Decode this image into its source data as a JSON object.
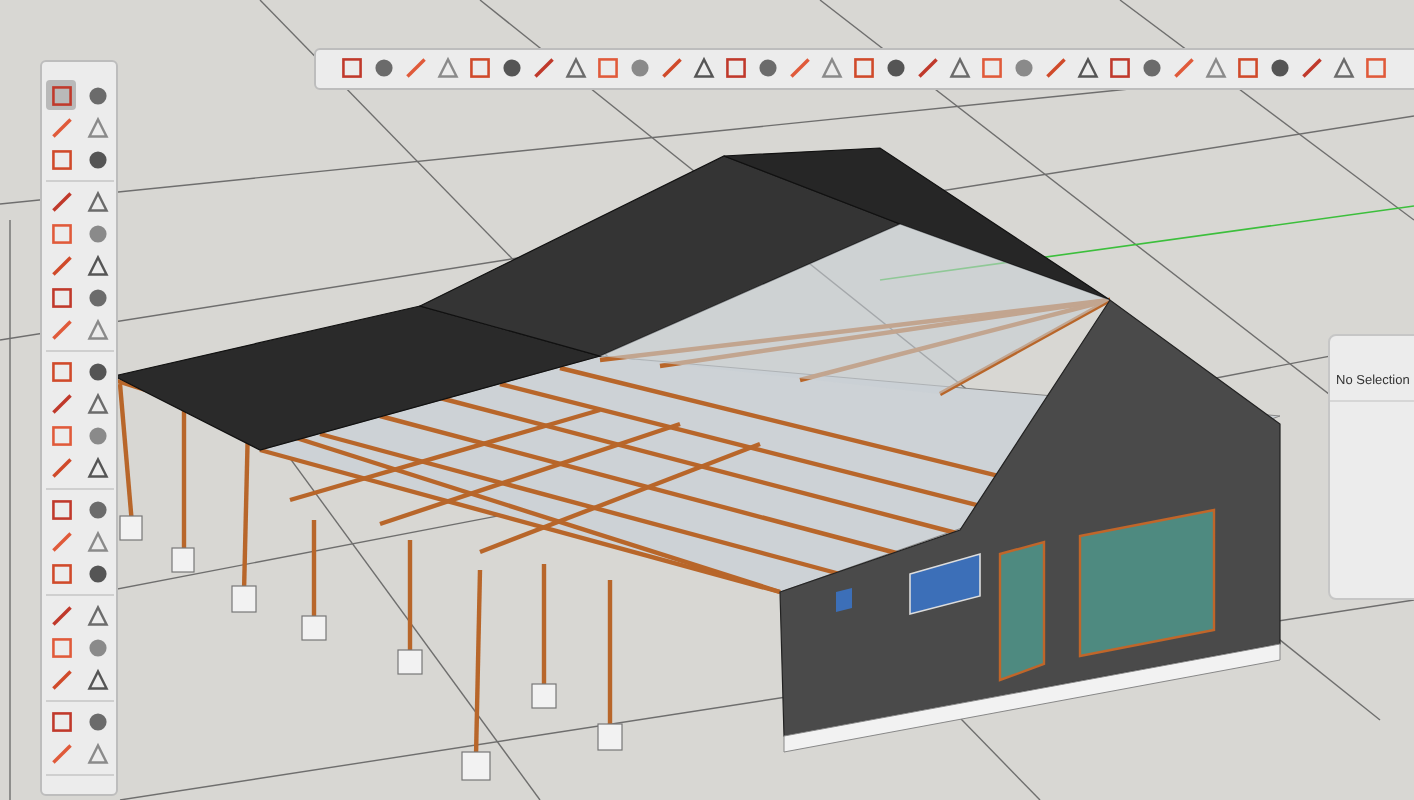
{
  "top_toolbar": {
    "tools": [
      {
        "selected": false
      },
      {
        "selected": false
      },
      {
        "selected": false
      },
      {
        "selected": false
      },
      {
        "selected": false
      },
      {
        "selected": false
      },
      {
        "selected": false
      },
      {
        "selected": false
      },
      {
        "selected": false
      },
      {
        "selected": false
      },
      {
        "selected": false
      },
      {
        "selected": false
      },
      {
        "selected": false
      },
      {
        "selected": false
      },
      {
        "selected": false
      },
      {
        "selected": false
      },
      {
        "selected": false
      },
      {
        "selected": false
      },
      {
        "selected": false
      },
      {
        "selected": false
      },
      {
        "selected": false
      },
      {
        "selected": false
      },
      {
        "selected": false
      },
      {
        "selected": false
      },
      {
        "selected": false
      },
      {
        "selected": false
      },
      {
        "selected": false
      },
      {
        "selected": false
      },
      {
        "selected": false
      },
      {
        "selected": false
      },
      {
        "selected": false
      },
      {
        "selected": false
      },
      {
        "selected": false
      }
    ]
  },
  "left_toolbar": {
    "groups": [
      {
        "tools": [
          {
            "selected": true
          },
          {
            "selected": false
          },
          {
            "selected": false
          },
          {
            "selected": false
          },
          {
            "selected": false
          },
          {
            "selected": false
          }
        ]
      },
      {
        "tools": [
          {
            "selected": false
          },
          {
            "selected": false
          },
          {
            "selected": false
          },
          {
            "selected": false
          },
          {
            "selected": false
          },
          {
            "selected": false
          },
          {
            "selected": false
          },
          {
            "selected": false
          },
          {
            "selected": false
          },
          {
            "selected": false
          }
        ]
      },
      {
        "tools": [
          {
            "selected": false
          },
          {
            "selected": false
          },
          {
            "selected": false
          },
          {
            "selected": false
          },
          {
            "selected": false
          },
          {
            "selected": false
          },
          {
            "selected": false
          },
          {
            "selected": false
          }
        ]
      },
      {
        "tools": [
          {
            "selected": false
          },
          {
            "selected": false
          },
          {
            "selected": false
          },
          {
            "selected": false
          },
          {
            "selected": false
          },
          {
            "selected": false
          }
        ]
      },
      {
        "tools": [
          {
            "selected": false
          },
          {
            "selected": false
          },
          {
            "selected": false
          },
          {
            "selected": false
          },
          {
            "selected": false
          },
          {
            "selected": false
          }
        ]
      },
      {
        "tools": [
          {
            "selected": false
          },
          {
            "selected": false
          },
          {
            "selected": false
          },
          {
            "selected": false
          }
        ]
      }
    ]
  },
  "inspector": {
    "title": "No Selection"
  }
}
